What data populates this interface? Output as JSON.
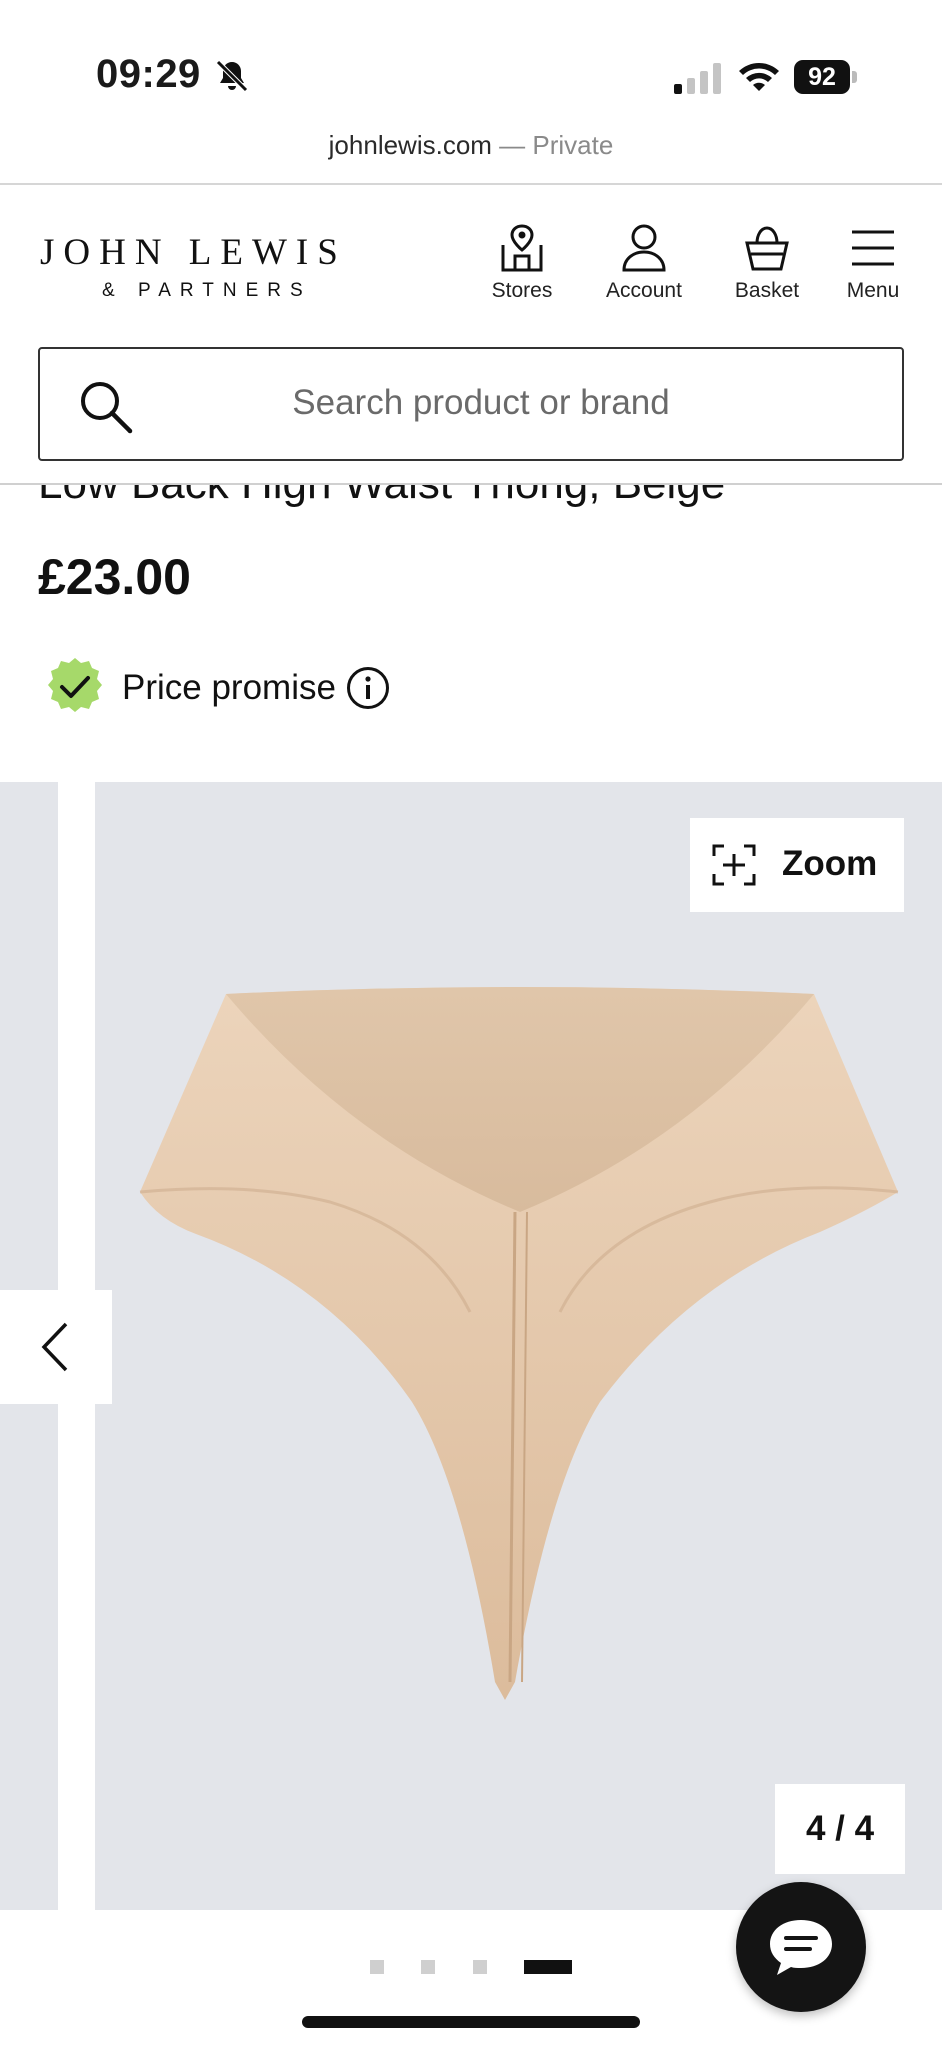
{
  "status_bar": {
    "time": "09:29",
    "battery": "92",
    "icons": [
      "bell-slash-icon",
      "signal-icon",
      "wifi-icon",
      "battery-icon"
    ]
  },
  "browser": {
    "domain": "johnlewis.com",
    "separator": " — ",
    "private_label": "Private"
  },
  "header": {
    "logo_main": "JOHN LEWIS",
    "logo_sub": "& PARTNERS",
    "nav": [
      {
        "label": "Stores",
        "icon": "store-location-icon"
      },
      {
        "label": "Account",
        "icon": "account-icon"
      },
      {
        "label": "Basket",
        "icon": "basket-icon"
      },
      {
        "label": "Menu",
        "icon": "menu-icon"
      }
    ],
    "search_placeholder": "Search product or brand"
  },
  "product": {
    "title": "Low Back High Waist Thong, Beige",
    "price": "£23.00",
    "price_promise_label": "Price promise"
  },
  "gallery": {
    "zoom_label": "Zoom",
    "counter": "4 / 4",
    "current_index": 4,
    "total": 4,
    "image_subject": "beige high waist thong",
    "background_color": "#e3e5ea"
  },
  "colors": {
    "promise_badge": "#a6d96a",
    "text": "#111111",
    "chat_button": "#141414"
  }
}
